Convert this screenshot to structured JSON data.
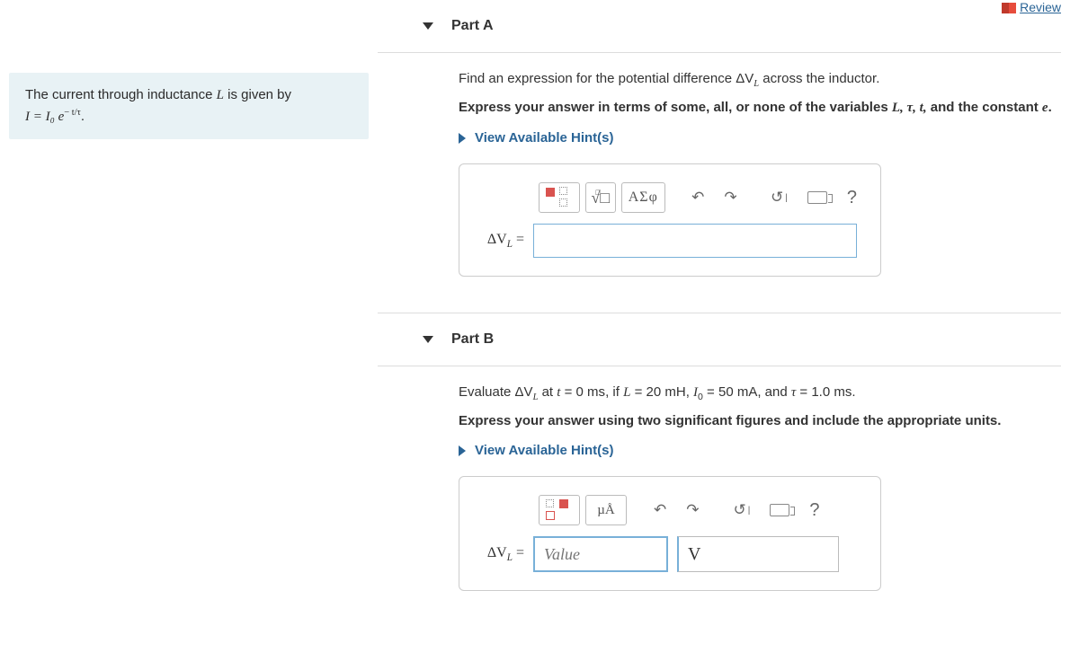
{
  "header": {
    "review_label": "Review"
  },
  "problem": {
    "line1_prefix": "The current through inductance ",
    "line1_var": "L",
    "line1_suffix": " is given by",
    "equation_html": "I = I₀ e",
    "equation_exp": "− t/τ",
    "equation_end": "."
  },
  "partA": {
    "title": "Part A",
    "question": "Find an expression for the potential difference ΔV",
    "question_sub": "L",
    "question_end": " across the inductor.",
    "instruction_prefix": "Express your answer in terms of some, all, or none of the variables ",
    "instruction_vars": "L, τ, t,",
    "instruction_suffix": " and the constant ",
    "instruction_const": "e",
    "instruction_end": ".",
    "hints_label": "View Available Hint(s)",
    "toolbar": {
      "templates": "templates-icon",
      "sqrt": "√□",
      "greek": "ΑΣφ",
      "undo": "↶",
      "redo": "↷",
      "reset": "↺",
      "keyboard": "keyboard-icon",
      "help": "?"
    },
    "eq_label": "ΔV",
    "eq_label_sub": "L",
    "eq_label_eq": " ="
  },
  "partB": {
    "title": "Part B",
    "question_prefix": "Evaluate ΔV",
    "question_sub": "L",
    "question_mid1": " at ",
    "t_var": "t",
    "t_val": " = 0 ms",
    "mid2": ", if ",
    "L_var": "L",
    "L_val": " = 20 mH",
    "mid3": ", ",
    "I0_var": "I",
    "I0_sub": "0",
    "I0_val": " = 50 mA",
    "mid4": ", and ",
    "tau_var": "τ",
    "tau_val": " = 1.0 ms",
    "end": ".",
    "instruction": "Express your answer using two significant figures and include the appropriate units.",
    "hints_label": "View Available Hint(s)",
    "toolbar": {
      "templates": "templates-icon",
      "units": "µÅ",
      "undo": "↶",
      "redo": "↷",
      "reset": "↺",
      "keyboard": "keyboard-icon",
      "help": "?"
    },
    "eq_label": "ΔV",
    "eq_label_sub": "L",
    "eq_label_eq": " =",
    "value_placeholder": "Value",
    "unit_value": "V"
  }
}
